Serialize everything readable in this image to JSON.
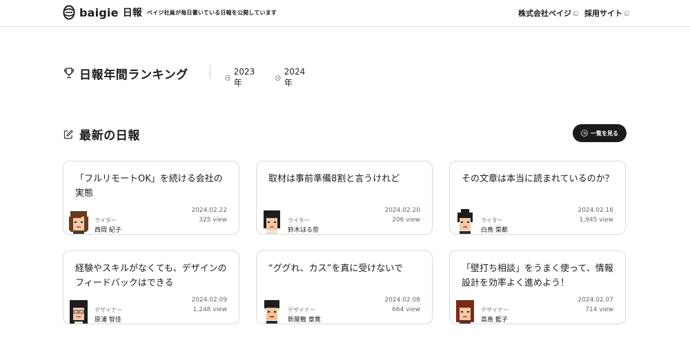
{
  "header": {
    "logo_word": "baigie",
    "logo_jp": "日報",
    "tagline": "ベイジ社員が毎日書いている日報を公開しています",
    "links": [
      {
        "label": "株式会社ベイジ"
      },
      {
        "label": "採用サイト"
      }
    ]
  },
  "ranking": {
    "title": "日報年間ランキング",
    "years": [
      "2023年",
      "2024年"
    ]
  },
  "latest": {
    "title": "最新の日報",
    "see_all": "一覧を見る"
  },
  "cards": [
    {
      "title": "「フルリモートOK」を続ける会社の実態",
      "date": "2024.02.22",
      "views": "325 view",
      "role": "ライター",
      "author": "西岡 紀子",
      "avatar": "avatar-woman-brown-hair"
    },
    {
      "title": "取材は事前準備8割と言うけれど",
      "date": "2024.02.20",
      "views": "206 view",
      "role": "ライター",
      "author": "鈴木はる奈",
      "avatar": "avatar-woman-black-hair"
    },
    {
      "title": "その文章は本当に読まれているのか？",
      "date": "2024.02.16",
      "views": "1,945 view",
      "role": "ライター",
      "author": "白鳥 菜都",
      "avatar": "avatar-woman-bun-hair"
    },
    {
      "title": "経験やスキルがなくても、デザインのフィードバックはできる",
      "date": "2024.02.09",
      "views": "1,248 view",
      "role": "デザイナー",
      "author": "原浦 智佳",
      "avatar": "avatar-woman-long-hair-glasses"
    },
    {
      "title": "“ググれ、カス”を真に受けないで",
      "date": "2024.02.08",
      "views": "664 view",
      "role": "デザイナー",
      "author": "新屋敷 章寛",
      "avatar": "avatar-man-black-hair"
    },
    {
      "title": "「壁打ち相談」をうまく使って、情報設計を効率よく進めよう！",
      "date": "2024.02.07",
      "views": "714 view",
      "role": "デザイナー",
      "author": "高島 藍子",
      "avatar": "avatar-woman-red-hair"
    }
  ]
}
